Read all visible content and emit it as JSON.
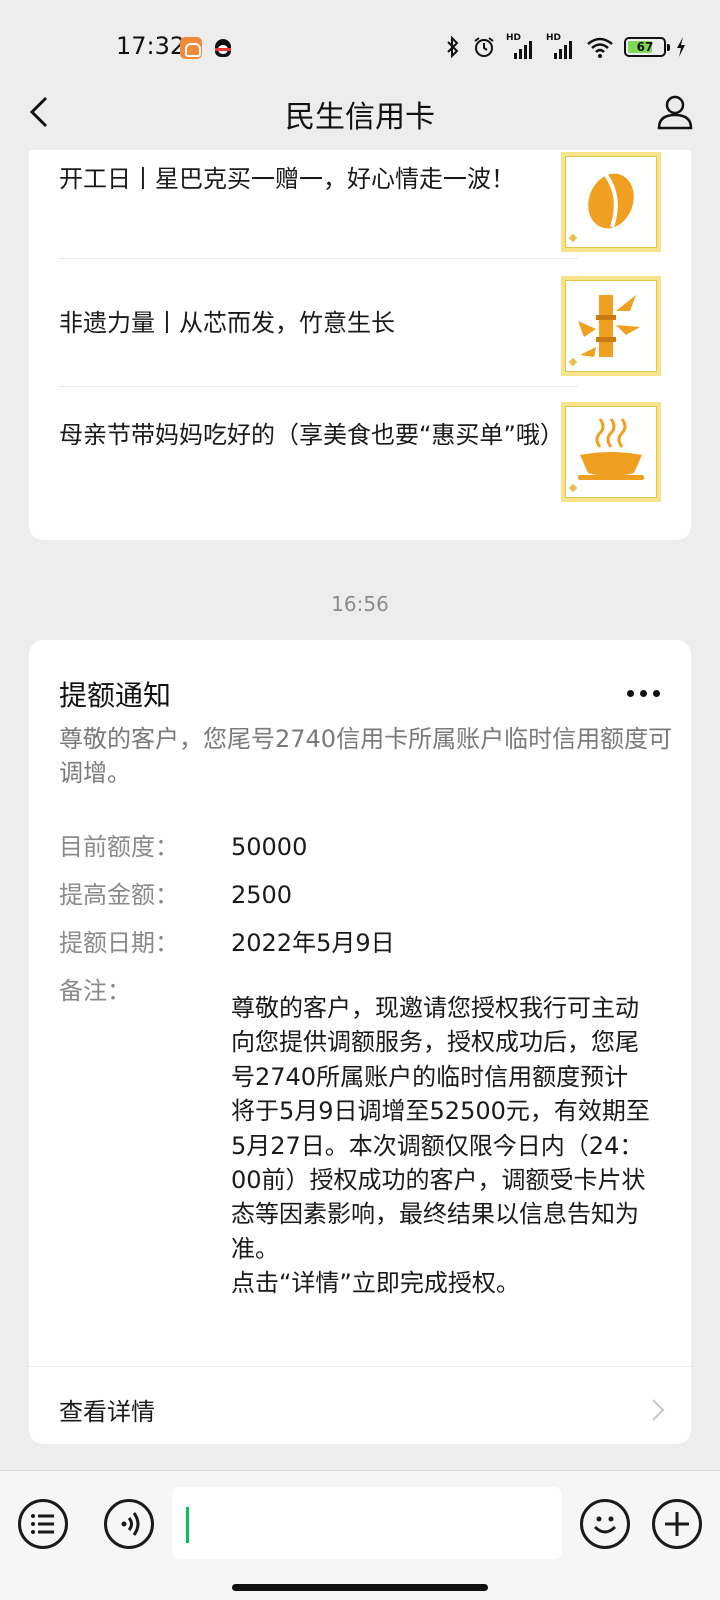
{
  "status_bar": {
    "time": "17:32",
    "battery_level": "67",
    "network_1": "HD",
    "network_2": "HD"
  },
  "header": {
    "title": "民生信用卡"
  },
  "articles": [
    {
      "title": "开工日丨星巴克买一赠一，好心情走一波！",
      "icon": "coffee-bean-icon"
    },
    {
      "title": "非遗力量丨从芯而发，竹意生长",
      "icon": "bamboo-icon"
    },
    {
      "title": "母亲节带妈妈吃好的（享美食也要“惠买单”哦）",
      "icon": "food-bowl-icon"
    }
  ],
  "timestamp": "16:56",
  "notice": {
    "title": "提额通知",
    "summary": "尊敬的客户，您尾号2740信用卡所属账户临时信用额度可调增。",
    "fields": [
      {
        "label": "目前额度：",
        "value": "50000"
      },
      {
        "label": "提高金额：",
        "value": "2500"
      },
      {
        "label": "提额日期：",
        "value": "2022年5月9日"
      },
      {
        "label": "备注：",
        "value": "尊敬的客户，现邀请您授权我行可主动向您提供调额服务，授权成功后，您尾号2740所属账户的临时信用额度预计将于5月9日调增至52500元，有效期至5月27日。本次调额仅限今日内（24：00前）授权成功的客户，调额受卡片状态等因素影响，最终结果以信息告知为准。"
      }
    ],
    "remark_note": "点击“详情”立即完成授权。",
    "view_details": "查看详情"
  },
  "colors": {
    "background": "#ededed",
    "card": "#ffffff",
    "accent_green": "#07c160",
    "thumb_gold": "#f0a020"
  }
}
